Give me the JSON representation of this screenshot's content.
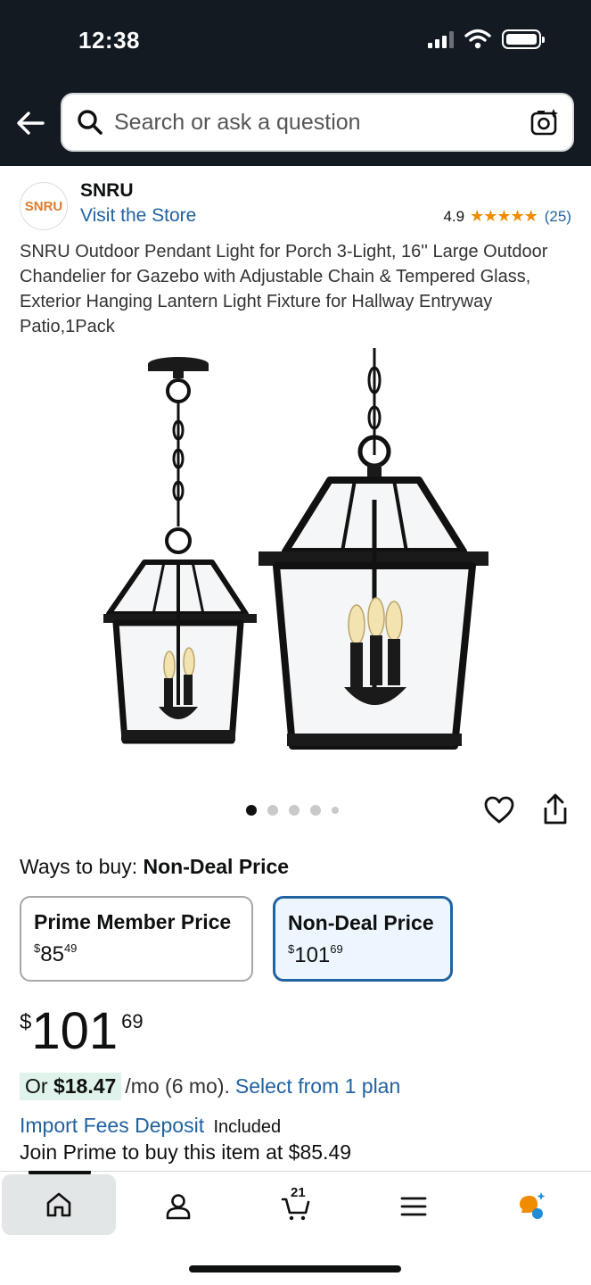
{
  "status_bar": {
    "time": "12:38"
  },
  "search": {
    "placeholder": "Search or ask a question"
  },
  "store": {
    "logo_text": "SNRU",
    "name": "SNRU",
    "link": "Visit the Store",
    "rating": "4.9",
    "stars": "★★★★★",
    "review_count": "(25)"
  },
  "product": {
    "title": "SNRU Outdoor Pendant Light for Porch 3-Light, 16'' Large Outdoor Chandelier for Gazebo with Adjustable Chain & Tempered Glass, Exterior Hanging Lantern Light Fixture for Hallway Entryway Patio,1Pack",
    "image_description_icon": "pendant-lantern-image",
    "carousel": {
      "total": 5,
      "active": 1
    }
  },
  "ways_to_buy": {
    "label": "Ways to buy:",
    "selected": "Non-Deal Price"
  },
  "price_options": [
    {
      "label": "Prime Member Price",
      "currency": "$",
      "whole": "85",
      "fraction": "49"
    },
    {
      "label": "Non-Deal Price",
      "currency": "$",
      "whole": "101",
      "fraction": "69"
    }
  ],
  "price": {
    "currency": "$",
    "whole": "101",
    "fraction": "69"
  },
  "installment": {
    "or": "Or",
    "amount": "$18.47",
    "term": "/mo (6 mo).",
    "link": "Select from 1 plan"
  },
  "import_fees": {
    "link": "Import Fees Deposit",
    "status": "Included"
  },
  "prime_offer": "Join Prime to buy this item at $85.49",
  "bottom_nav": {
    "cart_count": "21",
    "items": [
      "home-icon",
      "account-icon",
      "cart-icon",
      "menu-icon",
      "rufus-icon"
    ]
  },
  "colors": {
    "header_bg": "#131a22",
    "link": "#2162a1",
    "star": "#f08c00",
    "selected_border": "#2162a1"
  }
}
